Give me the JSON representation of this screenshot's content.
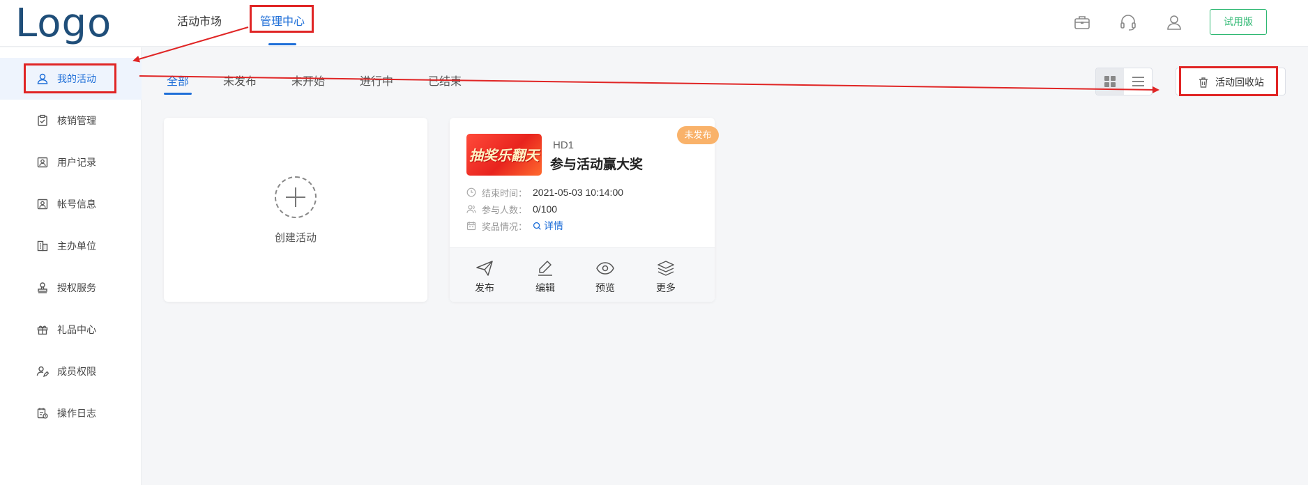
{
  "brand": {
    "logo_text": "Logo"
  },
  "topnav": [
    {
      "label": "活动市场"
    },
    {
      "label": "管理中心"
    }
  ],
  "header": {
    "trial_label": "试用版"
  },
  "sidebar": {
    "items": [
      {
        "label": "我的活动",
        "icon": "user-icon"
      },
      {
        "label": "核销管理",
        "icon": "clipboard-check-icon"
      },
      {
        "label": "用户记录",
        "icon": "id-card-icon"
      },
      {
        "label": "帐号信息",
        "icon": "id-badge-icon"
      },
      {
        "label": "主办单位",
        "icon": "building-icon"
      },
      {
        "label": "授权服务",
        "icon": "stamp-icon"
      },
      {
        "label": "礼品中心",
        "icon": "gift-icon"
      },
      {
        "label": "成员权限",
        "icon": "user-edit-icon"
      },
      {
        "label": "操作日志",
        "icon": "log-icon"
      }
    ]
  },
  "tabs": [
    {
      "label": "全部"
    },
    {
      "label": "未发布"
    },
    {
      "label": "未开始"
    },
    {
      "label": "进行中"
    },
    {
      "label": "已结束"
    }
  ],
  "toolbar": {
    "recycle_label": "活动回收站"
  },
  "create_card": {
    "label": "创建活动"
  },
  "activity": {
    "status": "未发布",
    "code": "HD1",
    "title": "参与活动赢大奖",
    "thumb_text": "抽奖乐翻天",
    "end_time_label": "结束时间：",
    "end_time": "2021-05-03 10:14:00",
    "participants_label": "参与人数：",
    "participants": "0/100",
    "prize_label": "奖品情况：",
    "prize_link": "详情",
    "actions": [
      {
        "label": "发布",
        "icon": "send-icon"
      },
      {
        "label": "编辑",
        "icon": "edit-icon"
      },
      {
        "label": "预览",
        "icon": "eye-icon"
      },
      {
        "label": "更多",
        "icon": "layers-icon"
      }
    ]
  },
  "colors": {
    "primary": "#1f6fd8",
    "brand": "#1f4e79",
    "trial_green": "#2eb872",
    "badge_orange": "#f9b26a",
    "annotation_red": "#e02525"
  }
}
